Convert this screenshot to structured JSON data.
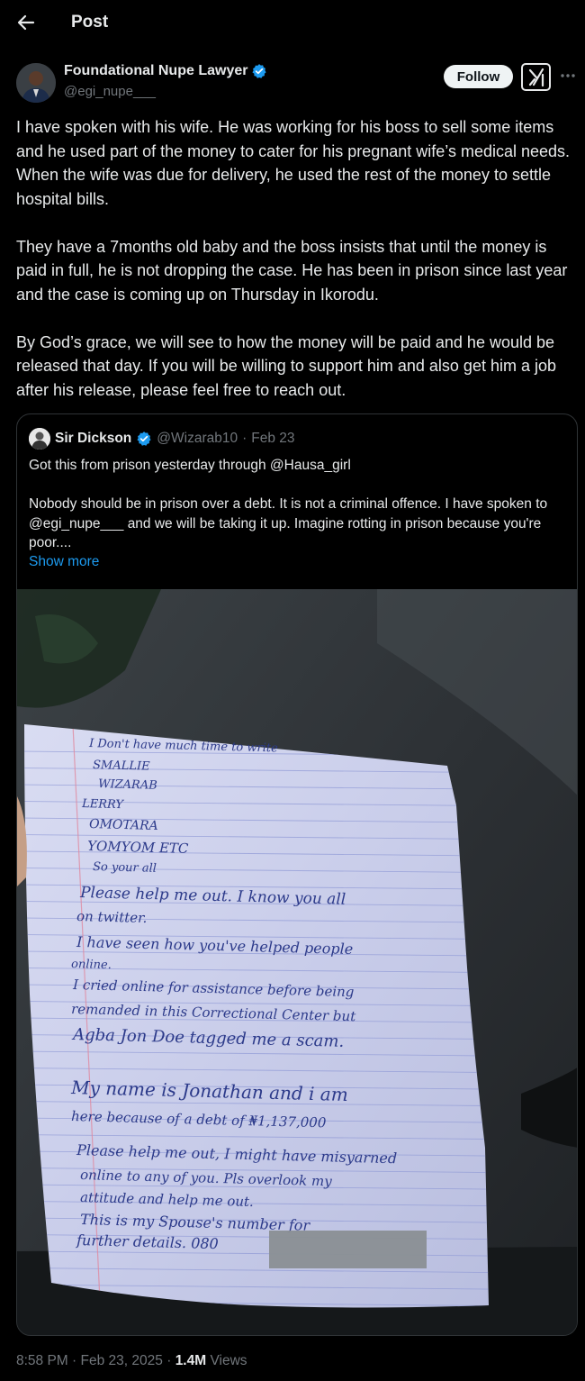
{
  "header": {
    "title": "Post",
    "back_icon": "arrow-left-icon"
  },
  "author": {
    "name": "Foundational Nupe Lawyer",
    "handle": "@egi_nupe___",
    "verified": true,
    "follow_label": "Follow",
    "grok_icon": "grok-icon",
    "more_icon": "more-icon"
  },
  "tweet": {
    "paragraphs": [
      "I have spoken with his wife. He was working for his boss to sell some items and he used part of the money to cater for his pregnant wife’s medical needs. When the wife was due for delivery, he used the rest of the money to settle hospital bills.",
      "They have a 7months old baby and the boss insists that until the money is paid in full, he is not dropping the case. He has been in prison since last year and the case is coming up on Thursday in Ikorodu.",
      "By God’s grace, we will see to how the money will be paid and he would be released that day. If you will be willing to support him and also get him a job after his release, please feel free to reach out."
    ]
  },
  "quote": {
    "name": "Sir Dickson",
    "handle": "@Wizarab10",
    "separator": "·",
    "date": "Feb 23",
    "verified": true,
    "paragraphs": [
      "Got this from prison yesterday through @Hausa_girl",
      "Nobody should be in prison over a debt. It is not a criminal offence. I have spoken to @egi_nupe___ and we will be taking it up. Imagine rotting in prison because you're poor...."
    ],
    "show_more": "Show more",
    "letter_lines": [
      "I Don't have much time to write",
      "SMALLIE",
      "WIZARAB",
      "LERRY",
      "OMOTARA",
      "YOMYOM ETC",
      "So your all",
      "Please help me out. I know you all",
      "on twitter.",
      "I have seen how you've helped people",
      "online.",
      "I cried online for assistance before being",
      "remanded in this Correctional Center but",
      "Agba Jon Doe tagged me a scam.",
      "My name is Jonathan and i am",
      "here because of a debt of ₦1,137,000",
      "Please help me out, I might have misyarned",
      "online to any of you. Pls overlook my",
      "attitude and help me out.",
      "This is my Spouse's number for",
      "further details. 080"
    ]
  },
  "footer": {
    "time": "8:58 PM",
    "sep1": "·",
    "date": "Feb 23, 2025",
    "sep2": "·",
    "views_count": "1.4M",
    "views_label": "Views"
  },
  "colors": {
    "background": "#000000",
    "text": "#e7e9ea",
    "muted": "#71767b",
    "accent": "#1d9bf0"
  }
}
